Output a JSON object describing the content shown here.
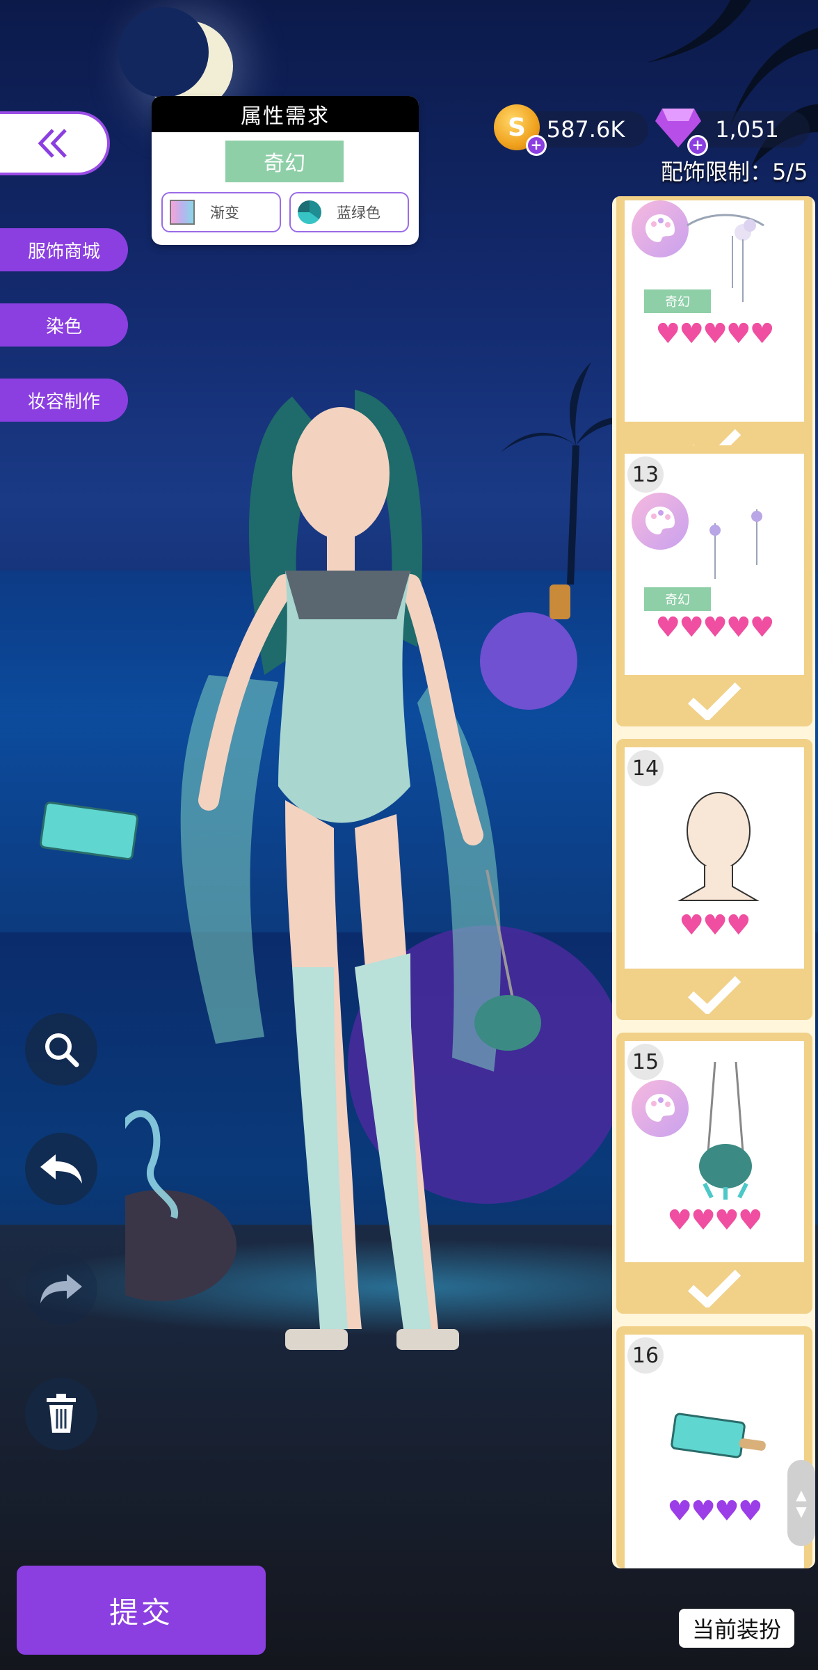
{
  "nav": {
    "back_icon": "double-chevron-left-icon",
    "side_menu": [
      "服饰商城",
      "染色",
      "妆容制作"
    ]
  },
  "requirements": {
    "title": "属性需求",
    "style_tag": "奇幻",
    "chips": [
      {
        "label": "渐变",
        "icon": "gradient-swatch"
      },
      {
        "label": "蓝绿色",
        "icon": "teal-swatch"
      }
    ]
  },
  "currency": {
    "coins": "587.6K",
    "gems": "1,051",
    "limit_label": "配饰限制：5/5"
  },
  "items": [
    {
      "number": "",
      "dyeable": true,
      "tag": "奇幻",
      "hearts": "♥♥♥♥♥",
      "heart_color": "pink",
      "checked": true
    },
    {
      "number": "13",
      "dyeable": true,
      "tag": "奇幻",
      "hearts": "♥♥♥♥♥",
      "heart_color": "pink",
      "checked": true
    },
    {
      "number": "14",
      "dyeable": false,
      "tag": "",
      "hearts": "♥♥♥",
      "heart_color": "pink",
      "checked": true
    },
    {
      "number": "15",
      "dyeable": true,
      "tag": "",
      "hearts": "♥♥♥♥",
      "heart_color": "pink",
      "checked": true
    },
    {
      "number": "16",
      "dyeable": false,
      "tag": "",
      "hearts": "♥♥♥♥",
      "heart_color": "purple",
      "checked": false
    }
  ],
  "tools": [
    "magnifier-icon",
    "undo-icon",
    "redo-icon",
    "trash-icon"
  ],
  "footer": {
    "submit_label": "提交",
    "current_outfit_label": "当前装扮"
  },
  "colors": {
    "accent": "#8b3fe0",
    "tag_green": "#8ecfa7",
    "card_gold": "#f1d088",
    "heart_pink": "#f04ea0",
    "heart_purple": "#9b3ee8"
  }
}
